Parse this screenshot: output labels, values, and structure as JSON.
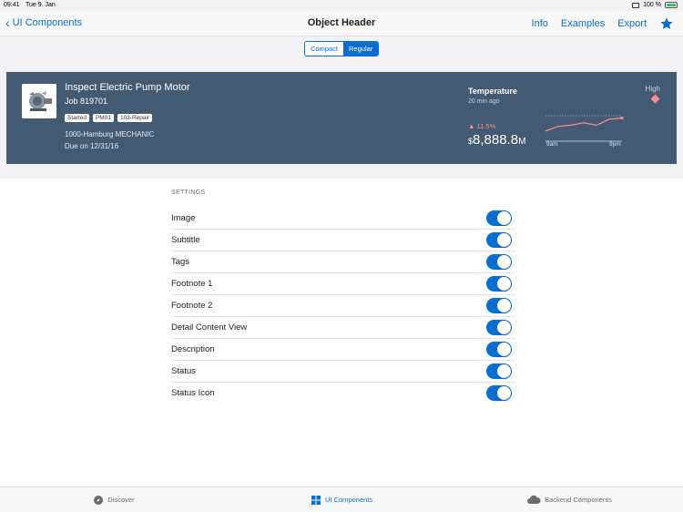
{
  "status_bar": {
    "time": "09:41",
    "date": "Tue 9. Jan",
    "battery": "100 %"
  },
  "nav": {
    "back_label": "UI Components",
    "title": "Object Header",
    "actions": [
      "Info",
      "Examples",
      "Export"
    ],
    "star_icon": "star-icon"
  },
  "segment": {
    "options": [
      "Compact",
      "Regular"
    ],
    "selected": "Regular"
  },
  "object_header": {
    "title": "Inspect Electric Pump Motor",
    "subtitle": "Job 819701",
    "tags": [
      "Started",
      "PM01",
      "103-Repair"
    ],
    "footnote1": "1000-Hamburg MECHANIC",
    "footnote2": "Due on 12/31/16",
    "kpi": {
      "title": "Temperature",
      "subtitle": "20 min ago",
      "trend": "11.5%",
      "currency": "$",
      "value": "8,888.8",
      "unit": "M"
    },
    "chart": {
      "x_labels": [
        "9am",
        "9pm"
      ],
      "values": [
        0.35,
        0.55,
        0.6,
        0.7,
        0.6,
        0.85,
        0.9
      ]
    },
    "status": "High",
    "colors": {
      "background": "#435a73",
      "negative": "#ff8b8b"
    }
  },
  "settings": {
    "header": "SETTINGS",
    "items": [
      {
        "label": "Image",
        "on": true
      },
      {
        "label": "Subtitle",
        "on": true
      },
      {
        "label": "Tags",
        "on": true
      },
      {
        "label": "Footnote 1",
        "on": true
      },
      {
        "label": "Footnote 2",
        "on": true
      },
      {
        "label": "Detail Content View",
        "on": true
      },
      {
        "label": "Description",
        "on": true
      },
      {
        "label": "Status",
        "on": true
      },
      {
        "label": "Status Icon",
        "on": true
      }
    ]
  },
  "tabs": [
    {
      "label": "Discover",
      "icon": "compass-icon",
      "active": false
    },
    {
      "label": "UI Components",
      "icon": "grid-icon",
      "active": true
    },
    {
      "label": "Backend Components",
      "icon": "cloud-icon",
      "active": false
    }
  ],
  "accent_color": "#0a6ed1"
}
